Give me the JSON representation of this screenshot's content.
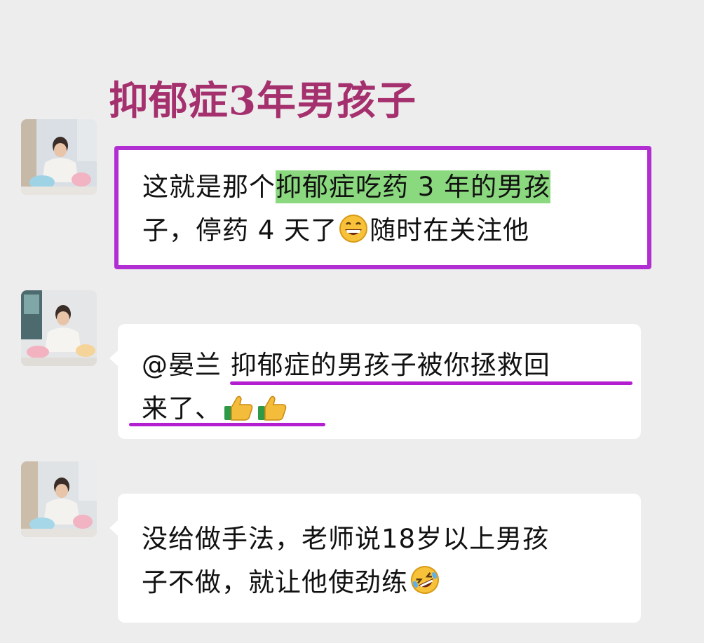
{
  "title": "抑郁症3年男孩子",
  "messages": [
    {
      "line1_pre": "这就是那个",
      "line1_highlight": "抑郁症吃药 3 年的男孩",
      "line2_pre": "子，停药 4 天了",
      "emoji": "grinning-face",
      "line2_post": "随时在关注他"
    },
    {
      "line1": "@晏兰  抑郁症的男孩子被你拯救回",
      "line2": "来了、",
      "emoji": "thumbs-up"
    },
    {
      "line1": "没给做手法，老师说18岁以上男孩",
      "line2": "子不做，就让他使劲练",
      "emoji": "rolling-on-floor-laughing"
    }
  ],
  "colors": {
    "title": "#a5306e",
    "frame": "#b12fd2",
    "highlight": "#8bd97f",
    "underline": "#b21ed0",
    "background": "#ededed"
  }
}
